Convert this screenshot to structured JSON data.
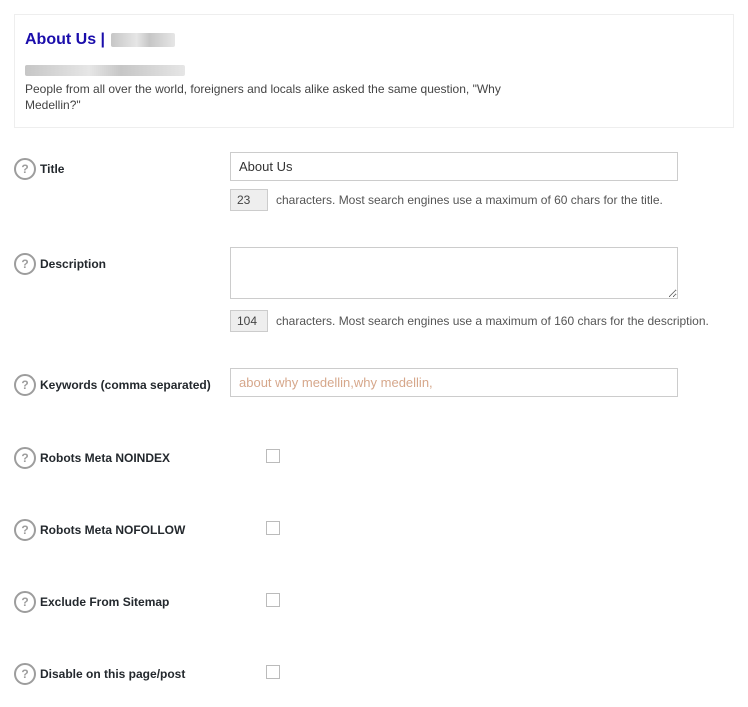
{
  "preview": {
    "title_prefix": "About Us |",
    "desc": "People from all over the world, foreigners and locals alike asked the same question, \"Why Medellin?\""
  },
  "fields": {
    "title": {
      "label": "Title",
      "value": "About Us",
      "count": "23",
      "hint": "characters. Most search engines use a maximum of 60 chars for the title."
    },
    "description": {
      "label": "Description",
      "value": "",
      "count": "104",
      "hint": "characters. Most search engines use a maximum of 160 chars for the description."
    },
    "keywords": {
      "label": "Keywords (comma separated)",
      "value": "about why medellin,why medellin,"
    },
    "noindex": {
      "label": "Robots Meta NOINDEX"
    },
    "nofollow": {
      "label": "Robots Meta NOFOLLOW"
    },
    "exclude": {
      "label": "Exclude From Sitemap"
    },
    "disable": {
      "label": "Disable on this page/post"
    }
  }
}
